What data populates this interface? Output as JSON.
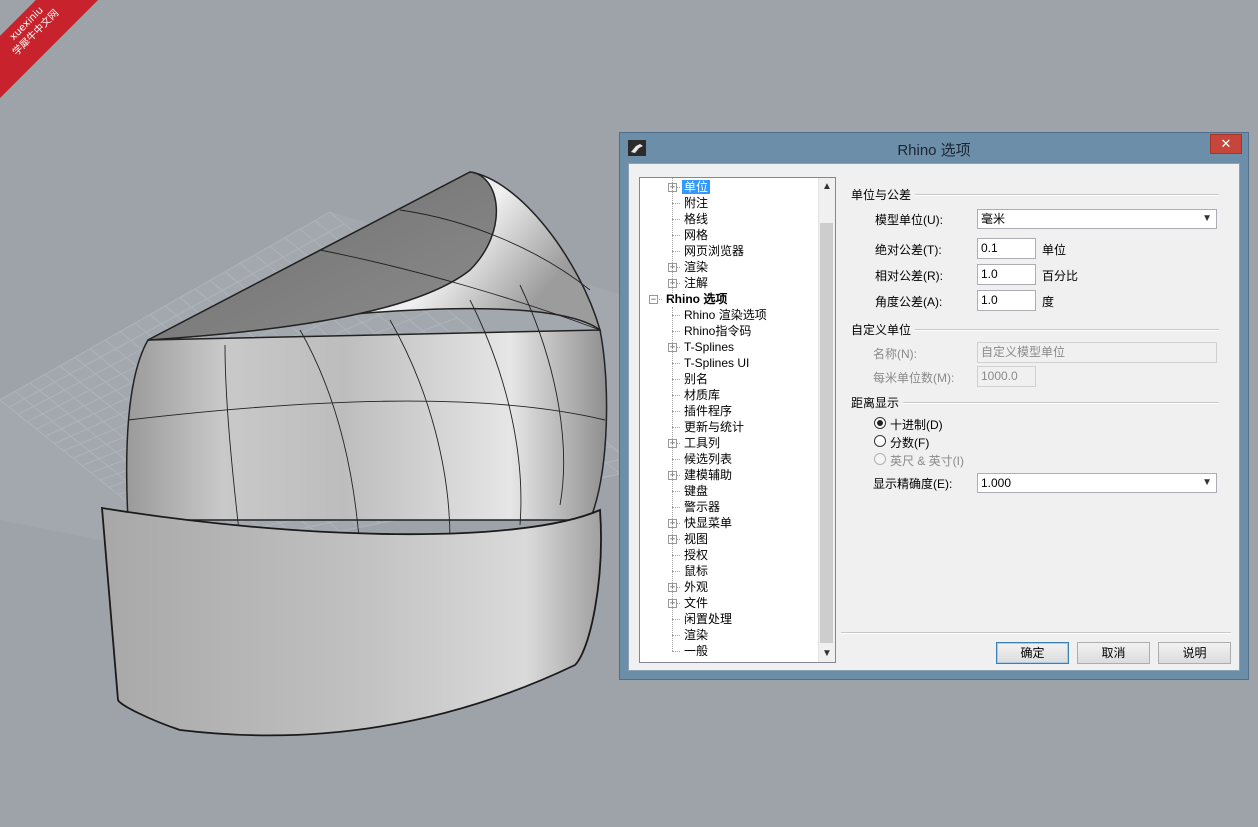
{
  "watermark": {
    "line1": "xuexiniu",
    "line2": "学犀牛中文网"
  },
  "dialog": {
    "title": "Rhino 选项",
    "close_glyph": "✕",
    "tree": {
      "items": [
        {
          "label": "单位",
          "expander": "+",
          "selected": true
        },
        {
          "label": "附注"
        },
        {
          "label": "格线"
        },
        {
          "label": "网格"
        },
        {
          "label": "网页浏览器"
        },
        {
          "label": "渲染",
          "expander": "+"
        },
        {
          "label": "注解",
          "expander": "+"
        },
        {
          "label": "Rhino 选项",
          "expander": "−",
          "bold": true
        },
        {
          "label": "Rhino 渲染选项"
        },
        {
          "label": "Rhino指令码"
        },
        {
          "label": "T-Splines",
          "expander": "+"
        },
        {
          "label": "T-Splines UI"
        },
        {
          "label": "别名"
        },
        {
          "label": "材质库"
        },
        {
          "label": "插件程序"
        },
        {
          "label": "更新与统计"
        },
        {
          "label": "工具列",
          "expander": "+"
        },
        {
          "label": "候选列表"
        },
        {
          "label": "建模辅助",
          "expander": "+"
        },
        {
          "label": "键盘"
        },
        {
          "label": "警示器"
        },
        {
          "label": "快显菜单",
          "expander": "+"
        },
        {
          "label": "视图",
          "expander": "+"
        },
        {
          "label": "授权"
        },
        {
          "label": "鼠标"
        },
        {
          "label": "外观",
          "expander": "+"
        },
        {
          "label": "文件",
          "expander": "+"
        },
        {
          "label": "闲置处理"
        },
        {
          "label": "渲染"
        },
        {
          "label": "一般"
        }
      ],
      "scroll_up": "▲",
      "scroll_down": "▼"
    },
    "units": {
      "group_title": "单位与公差",
      "model_units_label": "模型单位(U):",
      "model_units_value": "毫米",
      "abs_tol_label": "绝对公差(T):",
      "abs_tol_value": "0.1",
      "abs_tol_unit": "单位",
      "rel_tol_label": "相对公差(R):",
      "rel_tol_value": "1.0",
      "rel_tol_unit": "百分比",
      "angle_tol_label": "角度公差(A):",
      "angle_tol_value": "1.0",
      "angle_tol_unit": "度"
    },
    "custom_units": {
      "group_title": "自定义单位",
      "name_label": "名称(N):",
      "name_value": "自定义模型单位",
      "per_meter_label": "每米单位数(M):",
      "per_meter_value": "1000.0"
    },
    "distance_display": {
      "group_title": "距离显示",
      "decimal_label": "十进制(D)",
      "fractional_label": "分数(F)",
      "feet_inches_label": "英尺 & 英寸(I)",
      "selected": "decimal",
      "precision_label": "显示精确度(E):",
      "precision_value": "1.000"
    },
    "buttons": {
      "ok": "确定",
      "cancel": "取消",
      "help": "说明"
    },
    "dropdown_glyph": "▼"
  },
  "colors": {
    "viewport_bg": "#9ea3aa",
    "titlebar": "#6d8ea8",
    "close": "#c7463b",
    "selection": "#3399ff"
  }
}
